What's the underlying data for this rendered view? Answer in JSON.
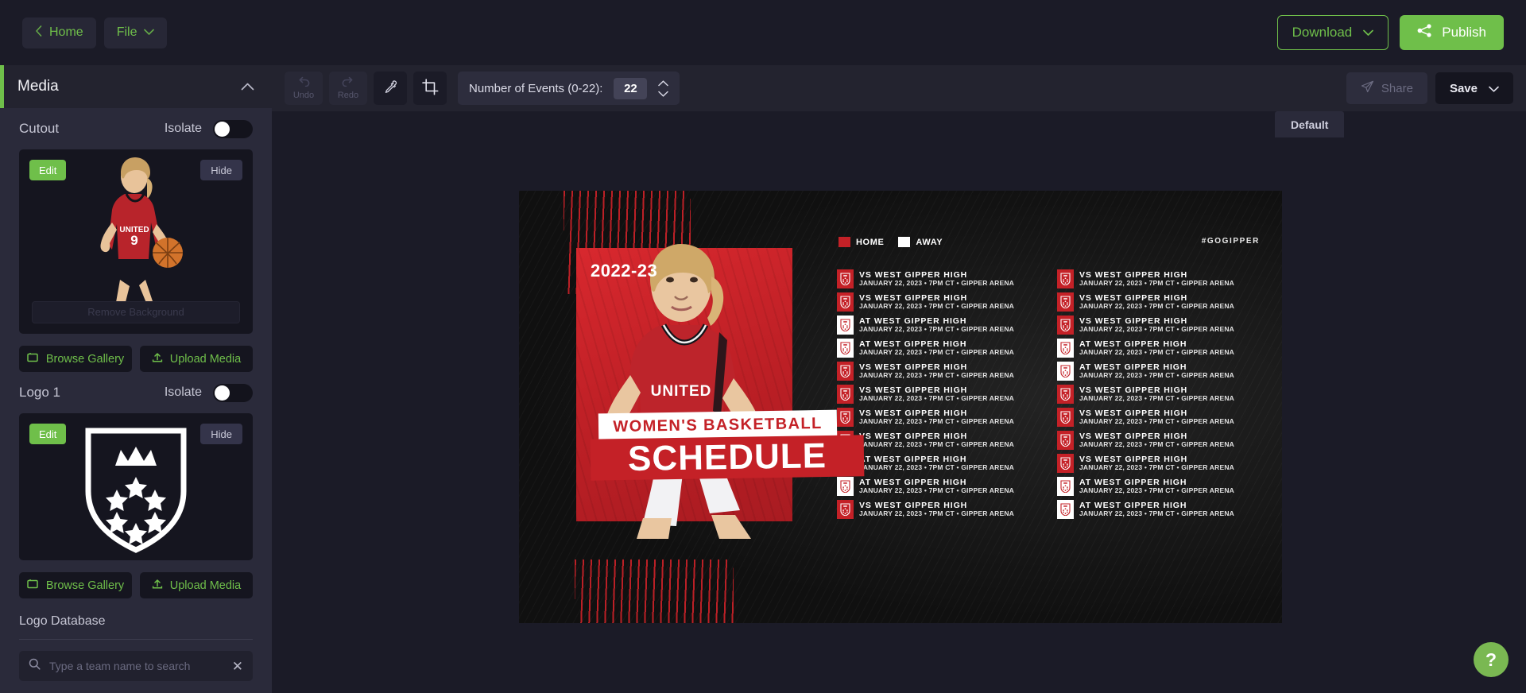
{
  "topbar": {
    "back_icon": "chevron-left-icon",
    "home_label": "Home",
    "file_label": "File",
    "file_caret": "chevron-down-icon",
    "download_label": "Download",
    "download_caret": "chevron-down-icon",
    "publish_label": "Publish",
    "publish_icon": "share-nodes-icon",
    "accent_green": "#6fbf4a"
  },
  "sidebar": {
    "title": "Media",
    "collapse_icon": "chevron-up-icon",
    "sections": [
      {
        "label": "Cutout",
        "isolate_label": "Isolate",
        "edit_label": "Edit",
        "hide_label": "Hide",
        "remove_bg_label": "Remove Background",
        "browse_label": "Browse Gallery",
        "browse_icon": "gallery-icon",
        "upload_label": "Upload Media",
        "upload_icon": "upload-icon"
      },
      {
        "label": "Logo 1",
        "isolate_label": "Isolate",
        "edit_label": "Edit",
        "hide_label": "Hide",
        "browse_label": "Browse Gallery",
        "browse_icon": "gallery-icon",
        "upload_label": "Upload Media",
        "upload_icon": "upload-icon"
      }
    ],
    "logo_database_label": "Logo Database",
    "search_icon": "search-icon",
    "search_placeholder": "Type a team name to search",
    "search_value": "",
    "clear_icon": "close-icon"
  },
  "toolbar": {
    "undo_label": "Undo",
    "undo_icon": "undo-arrow-icon",
    "redo_label": "Redo",
    "redo_icon": "redo-arrow-icon",
    "eyedropper_icon": "eyedropper-icon",
    "crop_icon": "crop-icon",
    "events_label": "Number of Events (0-22):",
    "events_value": "22",
    "spinner_up_icon": "chevron-up-icon",
    "spinner_down_icon": "chevron-down-icon",
    "share_label": "Share",
    "share_icon": "paper-plane-icon",
    "save_label": "Save",
    "save_caret": "chevron-down-icon"
  },
  "canvas": {
    "preset_tab_label": "Default",
    "help_label": "?"
  },
  "design": {
    "year": "2022-23",
    "subtitle": "WOMEN'S BASKETBALL",
    "title": "SCHEDULE",
    "hashtag": "#GOGIPPER",
    "legend": [
      {
        "label": "HOME",
        "color": "#c42127"
      },
      {
        "label": "AWAY",
        "color": "#ffffff"
      }
    ],
    "accent_red": "#c42127",
    "events": [
      {
        "prefix": "VS",
        "opponent": "WEST GIPPER HIGH",
        "meta": "JANUARY 22, 2023 • 7PM CT • GIPPER ARENA",
        "type": "home"
      },
      {
        "prefix": "VS",
        "opponent": "WEST GIPPER HIGH",
        "meta": "JANUARY 22, 2023 • 7PM CT • GIPPER ARENA",
        "type": "home"
      },
      {
        "prefix": "AT",
        "opponent": "WEST GIPPER HIGH",
        "meta": "JANUARY 22, 2023 • 7PM CT • GIPPER ARENA",
        "type": "away"
      },
      {
        "prefix": "AT",
        "opponent": "WEST GIPPER HIGH",
        "meta": "JANUARY 22, 2023 • 7PM CT • GIPPER ARENA",
        "type": "away"
      },
      {
        "prefix": "VS",
        "opponent": "WEST GIPPER HIGH",
        "meta": "JANUARY 22, 2023 • 7PM CT • GIPPER ARENA",
        "type": "home"
      },
      {
        "prefix": "VS",
        "opponent": "WEST GIPPER HIGH",
        "meta": "JANUARY 22, 2023 • 7PM CT • GIPPER ARENA",
        "type": "home"
      },
      {
        "prefix": "VS",
        "opponent": "WEST GIPPER HIGH",
        "meta": "JANUARY 22, 2023 • 7PM CT • GIPPER ARENA",
        "type": "home"
      },
      {
        "prefix": "VS",
        "opponent": "WEST GIPPER HIGH",
        "meta": "JANUARY 22, 2023 • 7PM CT • GIPPER ARENA",
        "type": "home"
      },
      {
        "prefix": "AT",
        "opponent": "WEST GIPPER HIGH",
        "meta": "JANUARY 22, 2023 • 7PM CT • GIPPER ARENA",
        "type": "away"
      },
      {
        "prefix": "AT",
        "opponent": "WEST GIPPER HIGH",
        "meta": "JANUARY 22, 2023 • 7PM CT • GIPPER ARENA",
        "type": "away"
      },
      {
        "prefix": "VS",
        "opponent": "WEST GIPPER HIGH",
        "meta": "JANUARY 22, 2023 • 7PM CT • GIPPER ARENA",
        "type": "home"
      },
      {
        "prefix": "VS",
        "opponent": "WEST GIPPER HIGH",
        "meta": "JANUARY 22, 2023 • 7PM CT • GIPPER ARENA",
        "type": "home"
      },
      {
        "prefix": "VS",
        "opponent": "WEST GIPPER HIGH",
        "meta": "JANUARY 22, 2023 • 7PM CT • GIPPER ARENA",
        "type": "home"
      },
      {
        "prefix": "VS",
        "opponent": "WEST GIPPER HIGH",
        "meta": "JANUARY 22, 2023 • 7PM CT • GIPPER ARENA",
        "type": "home"
      },
      {
        "prefix": "AT",
        "opponent": "WEST GIPPER HIGH",
        "meta": "JANUARY 22, 2023 • 7PM CT • GIPPER ARENA",
        "type": "away"
      },
      {
        "prefix": "AT",
        "opponent": "WEST GIPPER HIGH",
        "meta": "JANUARY 22, 2023 • 7PM CT • GIPPER ARENA",
        "type": "away"
      },
      {
        "prefix": "VS",
        "opponent": "WEST GIPPER HIGH",
        "meta": "JANUARY 22, 2023 • 7PM CT • GIPPER ARENA",
        "type": "home"
      },
      {
        "prefix": "VS",
        "opponent": "WEST GIPPER HIGH",
        "meta": "JANUARY 22, 2023 • 7PM CT • GIPPER ARENA",
        "type": "home"
      },
      {
        "prefix": "VS",
        "opponent": "WEST GIPPER HIGH",
        "meta": "JANUARY 22, 2023 • 7PM CT • GIPPER ARENA",
        "type": "home"
      },
      {
        "prefix": "VS",
        "opponent": "WEST GIPPER HIGH",
        "meta": "JANUARY 22, 2023 • 7PM CT • GIPPER ARENA",
        "type": "home"
      },
      {
        "prefix": "AT",
        "opponent": "WEST GIPPER HIGH",
        "meta": "JANUARY 22, 2023 • 7PM CT • GIPPER ARENA",
        "type": "away"
      },
      {
        "prefix": "AT",
        "opponent": "WEST GIPPER HIGH",
        "meta": "JANUARY 22, 2023 • 7PM CT • GIPPER ARENA",
        "type": "away"
      }
    ]
  }
}
